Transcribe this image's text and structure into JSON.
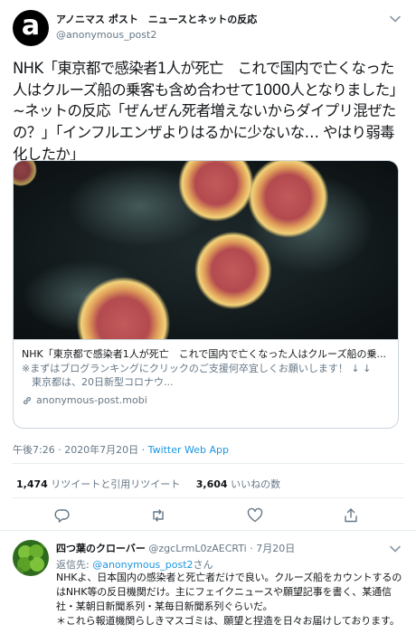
{
  "tweet": {
    "author_name": "アノニマス ポスト　ニュースとネットの反応",
    "author_handle": "@anonymous_post2",
    "text": "NHK「東京都で感染者1人が死亡　これで国内で亡くなった人はクルーズ船の乗客も含め合わせて1000人となりました」~ネットの反応「ぜんぜん死者増えないからダイプリ混ぜたの？」「インフルエンザよりはるかに少ないな… やはり弱毒化したか」",
    "card": {
      "title": "NHK「東京都で感染者1人が死亡　これで国内で亡くなった人はクルーズ船の乗...",
      "description": "※まずはブログランキングにクリックのご支援何卒宜しくお願いします！ ↓ ↓ 　東京都は、20日新型コロナウ...",
      "domain": "anonymous-post.mobi"
    },
    "timestamp": "午後7:26 · 2020年7月20日 · ",
    "source": "Twitter Web App",
    "stats": {
      "retweets": "1,474",
      "retweets_label": "リツイートと引用リツイート",
      "likes": "3,604",
      "likes_label": "いいねの数"
    }
  },
  "reply": {
    "author_name": "四つ葉のクローバー",
    "author_handle": "@zgcLrmL0zAECRTi",
    "date": "· 7月20日",
    "reply_to_prefix": "返信先: ",
    "reply_to_mention": "@anonymous_post2",
    "reply_to_suffix": "さん",
    "text": "NHKよ、日本国内の感染者と死亡者だけで良い。クルーズ船をカウントするのはNHK等の反日機関だけ。主にフェイクニュースや願望記事を書く、某通信社・某朝日新聞系列・某毎日新聞系列ぐらいだ。\n＊これら報道機関らしきマスゴミは、願望と捏造を日々お届けしております。"
  },
  "icons": {
    "avatar_main": "anonymous-logo-avatar",
    "caret": "chevron-down-icon",
    "reply": "reply-icon",
    "retweet": "retweet-icon",
    "like": "heart-icon",
    "share": "share-icon",
    "link": "link-icon",
    "avatar_reply": "clover-avatar"
  },
  "colors": {
    "link_blue": "#1b95e0",
    "secondary_text": "#657786",
    "border": "#e6ecf0"
  }
}
